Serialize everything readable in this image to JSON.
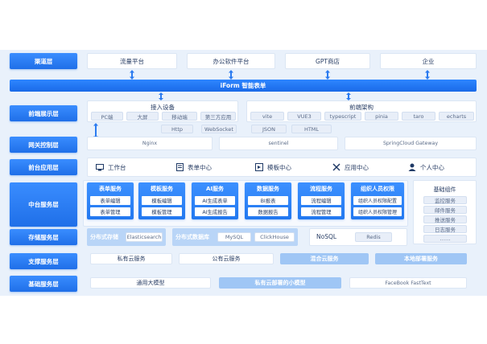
{
  "colors": {
    "accent": "#1f6fe8",
    "light_blue": "#9fc6f5",
    "bg": "#e9f1fb"
  },
  "layers": {
    "channel": "渠道层",
    "frontend": "前端展示层",
    "gateway": "网关控制层",
    "frontapp": "前台应用层",
    "middle": "中台服务层",
    "storage": "存储服务层",
    "support": "支撑服务层",
    "base": "基础服务层"
  },
  "channel_items": [
    "流量平台",
    "办公软件平台",
    "GPT商店",
    "企业"
  ],
  "iform_bar": "iForm 智能表单",
  "frontend": {
    "access_title": "接入设备",
    "access_items": [
      "PC端",
      "大屏",
      "移动端",
      "第三方应用"
    ],
    "arch_title": "前端架构",
    "arch_items": [
      "vite",
      "VUE3",
      "typescript",
      "pinia",
      "taro",
      "echarts"
    ],
    "protocols": [
      "Http",
      "WebSocket",
      "JSON",
      "HTML"
    ]
  },
  "gateway_items": [
    "Nginx",
    "sentinel",
    "SpringCloud Gateway"
  ],
  "frontapp_items": [
    {
      "icon": "monitor-icon",
      "label": "工作台"
    },
    {
      "icon": "form-icon",
      "label": "表单中心"
    },
    {
      "icon": "template-icon",
      "label": "模板中心"
    },
    {
      "icon": "tools-icon",
      "label": "应用中心"
    },
    {
      "icon": "user-icon",
      "label": "个人中心"
    }
  ],
  "middle": {
    "services": [
      {
        "title": "表单服务",
        "items": [
          "表单编辑",
          "表单管理"
        ]
      },
      {
        "title": "模板服务",
        "items": [
          "模板编辑",
          "模板管理"
        ]
      },
      {
        "title": "AI服务",
        "items": [
          "AI生成表单",
          "AI生成报告"
        ]
      },
      {
        "title": "数据服务",
        "items": [
          "BI报表",
          "数据报告"
        ]
      },
      {
        "title": "流程服务",
        "items": [
          "流程编辑",
          "流程管理"
        ]
      },
      {
        "title": "组织人员权限",
        "items": [
          "组织人员权限配置",
          "组织人员权限管理"
        ]
      }
    ],
    "base_components_title": "基础组件",
    "base_components": [
      "监控服务",
      "邮件服务",
      "推送服务",
      "日志服务",
      "……"
    ]
  },
  "storage": {
    "dist_storage_label": "分布式存储",
    "dist_storage_items": [
      "Elasticsearch"
    ],
    "dist_db_label": "分布式数据库",
    "dist_db_items": [
      "MySQL",
      "ClickHouse"
    ],
    "nosql_label": "NoSQL",
    "nosql_items": [
      "Redis"
    ]
  },
  "support_items": [
    "私有云服务",
    "公有云服务",
    "混合云服务",
    "本地部署服务"
  ],
  "base_items": [
    "通用大模型",
    "私有云部署的小模型",
    "FaceBook FastText"
  ]
}
